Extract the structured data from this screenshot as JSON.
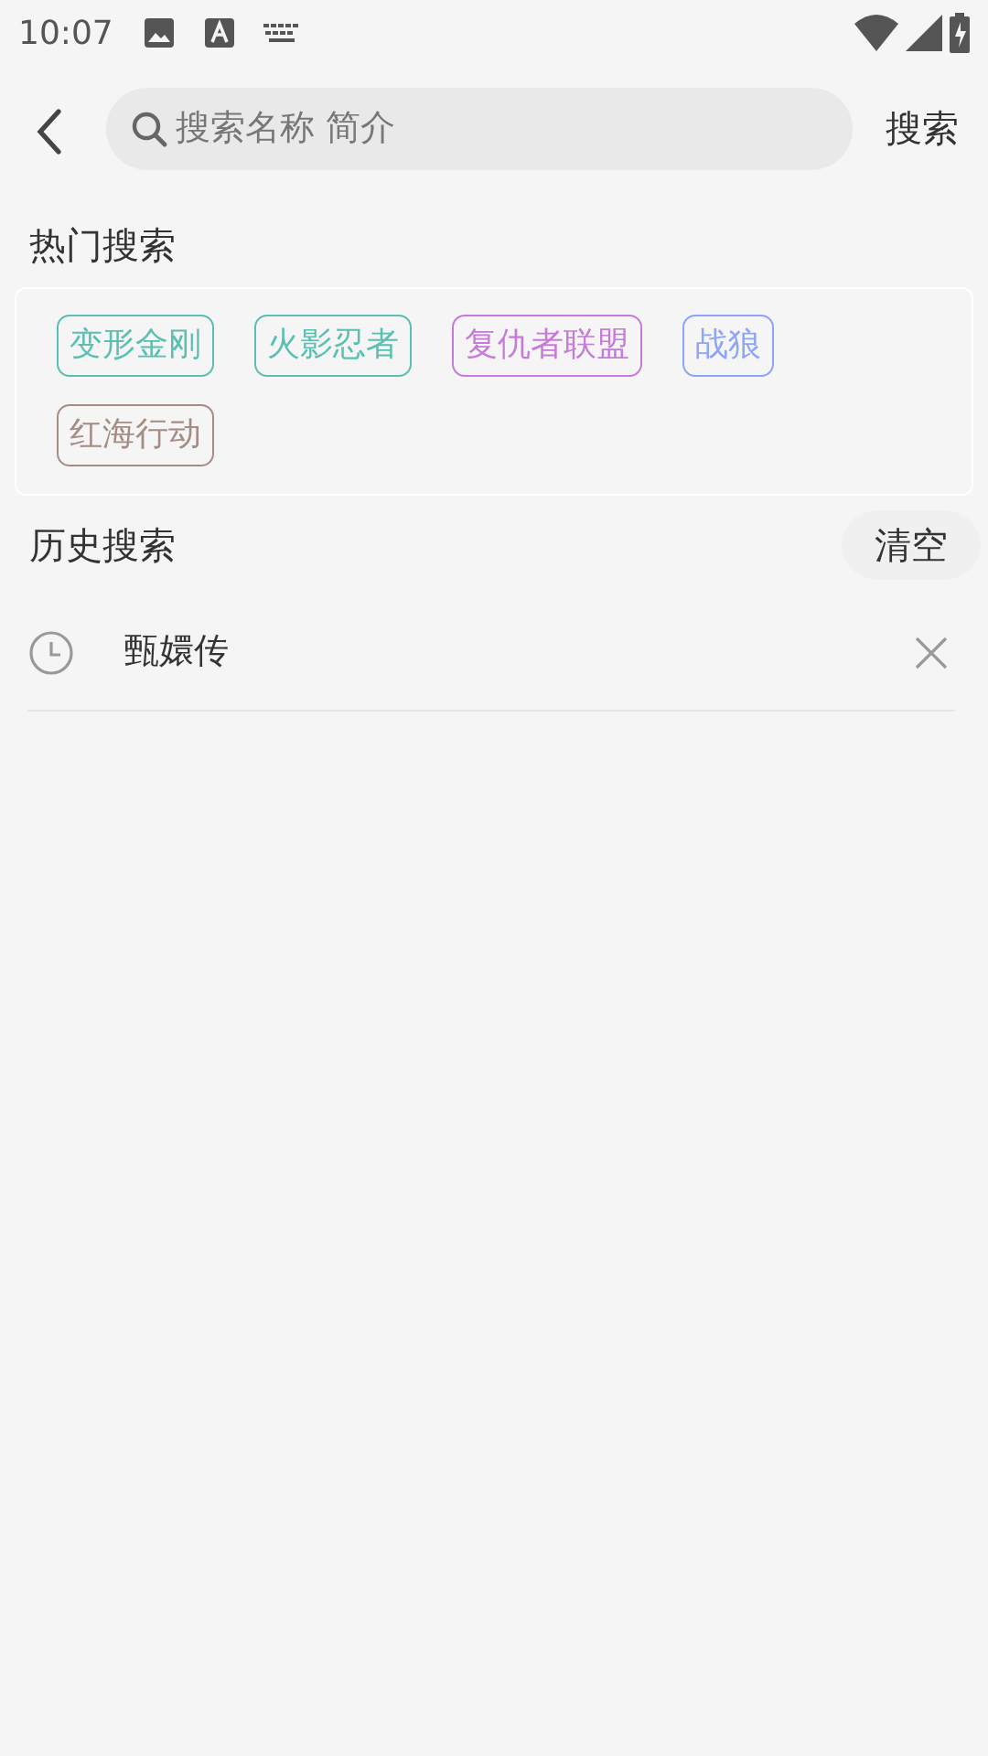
{
  "status_bar": {
    "time": "10:07"
  },
  "search": {
    "placeholder": "搜索名称 简介",
    "button": "搜索"
  },
  "hot": {
    "title": "热门搜索",
    "tags": [
      {
        "label": "变形金刚",
        "color": "#5bbfb2"
      },
      {
        "label": "火影忍者",
        "color": "#5bbfb2"
      },
      {
        "label": "复仇者联盟",
        "color": "#c77bd8"
      },
      {
        "label": "战狼",
        "color": "#8ea4f7"
      },
      {
        "label": "红海行动",
        "color": "#a58d84"
      }
    ]
  },
  "history": {
    "title": "历史搜索",
    "clear": "清空",
    "items": [
      {
        "label": "甄嬛传"
      }
    ]
  }
}
